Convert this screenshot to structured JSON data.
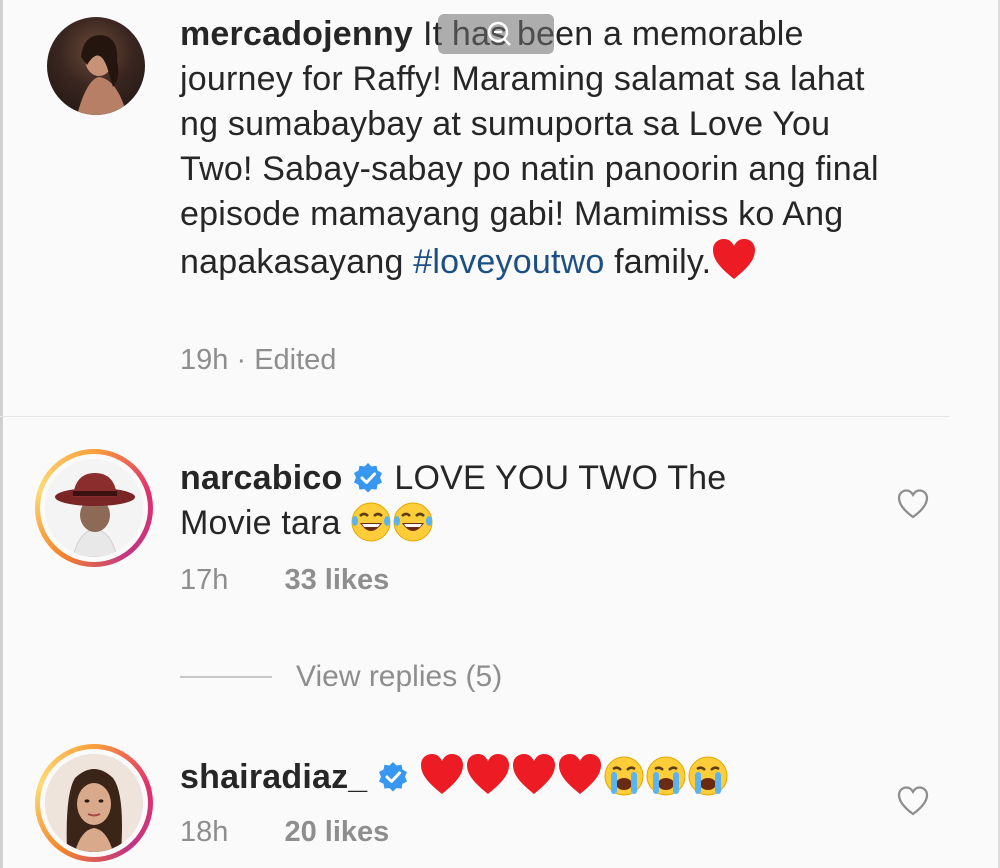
{
  "comments": [
    {
      "username": "mercadojenny",
      "text_before_hashtag": "It has been a memorable journey for Raffy! Maraming salamat sa lahat ng sumabaybay at sumuporta sa Love You Two! Sabay-sabay po natin panoorin ang final episode mamayang gabi! Mamimiss ko Ang napakasayang",
      "hashtag": "#loveyoutwo",
      "text_after_hashtag": "family.",
      "time": "19h",
      "separator": "·",
      "edited": "Edited"
    },
    {
      "username": "narcabico",
      "verified": true,
      "text": "LOVE YOU TWO The Movie tara",
      "emojis": [
        "laughing-crying",
        "laughing-crying"
      ],
      "time": "17h",
      "likes": "33 likes",
      "view_replies": "View replies (5)"
    },
    {
      "username": "shairadiaz_",
      "verified": true,
      "emojis": [
        "red-heart",
        "red-heart",
        "red-heart",
        "red-heart",
        "crying",
        "crying",
        "crying"
      ],
      "time": "18h",
      "likes": "20 likes"
    }
  ],
  "colors": {
    "hashtag": "#1c4f85",
    "meta_gray": "#8e8e8e",
    "verified_blue": "#3897f0",
    "heart_red": "#ed1c24"
  }
}
